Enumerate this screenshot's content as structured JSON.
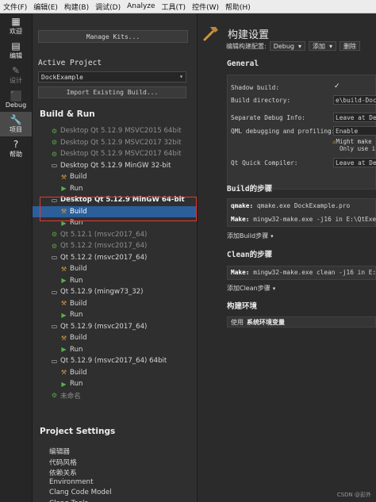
{
  "menubar": [
    "文件(F)",
    "编辑(E)",
    "构建(B)",
    "调试(D)",
    "Analyze",
    "工具(T)",
    "控件(W)",
    "帮助(H)"
  ],
  "modes": [
    {
      "label": "欢迎",
      "icon": "grid-icon",
      "glyph": "▦",
      "state": "normal"
    },
    {
      "label": "编辑",
      "icon": "edit-icon",
      "glyph": "▤",
      "state": "normal"
    },
    {
      "label": "设计",
      "icon": "pencil-icon",
      "glyph": "✎",
      "state": "disabled"
    },
    {
      "label": "Debug",
      "icon": "bug-icon",
      "glyph": "⬛",
      "state": "normal"
    },
    {
      "label": "项目",
      "icon": "wrench-icon",
      "glyph": "🔧",
      "state": "active"
    },
    {
      "label": "帮助",
      "icon": "help-icon",
      "glyph": "?",
      "state": "normal"
    }
  ],
  "left": {
    "manage_kits": "Manage Kits...",
    "active_project_label": "Active Project",
    "active_project_value": "DockExample",
    "import_build": "Import Existing Build...",
    "build_run_header": "Build & Run",
    "project_settings_header": "Project Settings"
  },
  "tree": [
    {
      "label": "Desktop Qt 5.12.9 MSVC2015 64bit",
      "icon": "gear",
      "indent": 22,
      "dim": true
    },
    {
      "label": "Desktop Qt 5.12.9 MSVC2017 32bit",
      "icon": "gear",
      "indent": 22,
      "dim": true
    },
    {
      "label": "Desktop Qt 5.12.9 MSVC2017 64bit",
      "icon": "gear",
      "indent": 22,
      "dim": true
    },
    {
      "label": "Desktop Qt 5.12.9 MinGW 32-bit",
      "icon": "monitor",
      "indent": 22
    },
    {
      "label": "Build",
      "icon": "hammer",
      "indent": 34
    },
    {
      "label": "Run",
      "icon": "play",
      "indent": 34
    },
    {
      "label": "Desktop Qt 5.12.9 MinGW 64-bit",
      "icon": "monitor",
      "indent": 22,
      "bold": true
    },
    {
      "label": "Build",
      "icon": "hammer",
      "indent": 34,
      "selected": true
    },
    {
      "label": "Run",
      "icon": "play",
      "indent": 34
    },
    {
      "label": "Qt 5.12.1 (msvc2017_64)",
      "icon": "gear",
      "indent": 22,
      "dim": true
    },
    {
      "label": "Qt 5.12.2 (msvc2017_64)",
      "icon": "gear",
      "indent": 22,
      "dim": true
    },
    {
      "label": "Qt 5.12.2 (msvc2017_64)",
      "icon": "monitor",
      "indent": 22
    },
    {
      "label": "Build",
      "icon": "hammer",
      "indent": 34
    },
    {
      "label": "Run",
      "icon": "play",
      "indent": 34
    },
    {
      "label": "Qt 5.12.9 (mingw73_32)",
      "icon": "monitor",
      "indent": 22
    },
    {
      "label": "Build",
      "icon": "hammer",
      "indent": 34
    },
    {
      "label": "Run",
      "icon": "play",
      "indent": 34
    },
    {
      "label": "Qt 5.12.9 (msvc2017_64)",
      "icon": "monitor",
      "indent": 22
    },
    {
      "label": "Build",
      "icon": "hammer",
      "indent": 34
    },
    {
      "label": "Run",
      "icon": "play",
      "indent": 34
    },
    {
      "label": "Qt 5.12.9 (msvc2017_64) 64bit",
      "icon": "monitor",
      "indent": 22
    },
    {
      "label": "Build",
      "icon": "hammer",
      "indent": 34
    },
    {
      "label": "Run",
      "icon": "play",
      "indent": 34
    },
    {
      "label": "未命名",
      "icon": "gear",
      "indent": 22,
      "dim": true
    }
  ],
  "project_settings": [
    "编辑器",
    "代码风格",
    "依赖关系",
    "Environment",
    "Clang Code Model",
    "Clang Tools",
    "Testing"
  ],
  "right": {
    "title": "构建设置",
    "config_label": "编辑构建配置:",
    "config_value": "Debug",
    "add_label": "添加",
    "delete_label": "删除",
    "general_header": "General",
    "shadow_build_label": "Shadow build:",
    "shadow_build_check": "✓",
    "build_dir_label": "Build directory:",
    "build_dir_value": "e\\build-DockEx",
    "separate_debug_label": "Separate Debug Info:",
    "separate_debug_value": "Leave at De",
    "qml_debug_label": "QML debugging and profiling:",
    "qml_debug_value": "Enable",
    "qml_warn_1": "Might make",
    "qml_warn_2": "Only use i",
    "quick_compiler_label": "Qt Quick Compiler:",
    "quick_compiler_value": "Leave at De",
    "build_steps_header": "Build的步骤",
    "qmake_key": "qmake:",
    "qmake_val": "qmake.exe DockExample.pro",
    "make_key": "Make:",
    "make_val": "mingw32-make.exe -j16 in E:\\QtExer",
    "add_build_step": "添加Build步骤",
    "clean_header": "Clean的步骤",
    "clean_make_val": "mingw32-make.exe clean -j16 in E:\\",
    "add_clean_step": "添加Clean步骤",
    "env_header": "构建环境",
    "env_use": "使用",
    "env_value": "系统环境变量"
  },
  "watermark": "CSDN @彭外"
}
